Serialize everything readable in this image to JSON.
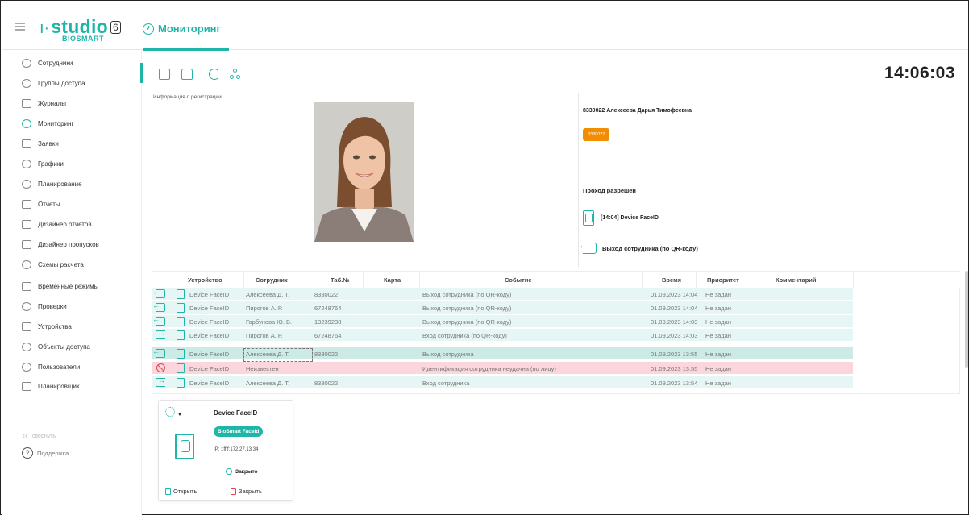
{
  "header": {
    "logo_text": "studio",
    "logo_version": "6",
    "logo_sub": "BIOSMART",
    "title": "Мониторинг"
  },
  "sidebar": {
    "items": [
      {
        "label": "Сотрудники",
        "icon": "person-icon"
      },
      {
        "label": "Группы доступа",
        "icon": "group-icon"
      },
      {
        "label": "Журналы",
        "icon": "journal-icon"
      },
      {
        "label": "Мониторинг",
        "icon": "gauge-icon"
      },
      {
        "label": "Заявки",
        "icon": "request-icon"
      },
      {
        "label": "Графики",
        "icon": "schedule-icon"
      },
      {
        "label": "Планирование",
        "icon": "planning-icon"
      },
      {
        "label": "Отчеты",
        "icon": "report-icon"
      },
      {
        "label": "Дизайнер отчетов",
        "icon": "report-designer-icon"
      },
      {
        "label": "Дизайнер пропусков",
        "icon": "pass-designer-icon"
      },
      {
        "label": "Схемы расчета",
        "icon": "calc-scheme-icon"
      },
      {
        "label": "Временные режимы",
        "icon": "time-mode-icon"
      },
      {
        "label": "Проверки",
        "icon": "eye-icon"
      },
      {
        "label": "Устройства",
        "icon": "devices-icon"
      },
      {
        "label": "Объекты доступа",
        "icon": "access-objects-icon"
      },
      {
        "label": "Пользователи",
        "icon": "users-icon"
      },
      {
        "label": "Планировщик",
        "icon": "scheduler-icon"
      }
    ],
    "collapse_label": "свернуть",
    "support_label": "Поддержка"
  },
  "clock": "14:06:03",
  "registration": {
    "caption": "Информация о регистрации",
    "employee_name": "8330022 Алексеева Дарья Тимофеевна",
    "badge": "8330022",
    "pass_status": "Проход разрешен",
    "device_line": "[14:04] Device FaceID",
    "event_line": "Выход сотрудника (по QR-коду)"
  },
  "table": {
    "headers": [
      "Устройство",
      "Сотрудник",
      "Таб.№",
      "Карта",
      "Событие",
      "Время",
      "Приоритет",
      "Комментарий"
    ],
    "rows": [
      {
        "icon": "exit",
        "device": "Device FaceID",
        "employee": "Алексеева Д. Т.",
        "tab": "8330022",
        "card": "",
        "event": "Выход сотрудника (по QR-коду)",
        "time": "01.09.2023 14:04",
        "priority": "Не задан",
        "comment": ""
      },
      {
        "icon": "exit",
        "device": "Device FaceID",
        "employee": "Пирогов А. Р.",
        "tab": "67248764",
        "card": "",
        "event": "Выход сотрудника (по QR-коду)",
        "time": "01.09.2023 14:04",
        "priority": "Не задан",
        "comment": ""
      },
      {
        "icon": "exit",
        "device": "Device FaceID",
        "employee": "Горбунова Ю. В.",
        "tab": "13239238",
        "card": "",
        "event": "Выход сотрудника (по QR-коду)",
        "time": "01.09.2023 14:03",
        "priority": "Не задан",
        "comment": ""
      },
      {
        "icon": "enter",
        "device": "Device FaceID",
        "employee": "Пирогов А. Р.",
        "tab": "67248764",
        "card": "",
        "event": "Вход сотрудника (по QR-коду)",
        "time": "01.09.2023 14:03",
        "priority": "Не задан",
        "comment": ""
      },
      {
        "icon": "exit",
        "device": "Device FaceID",
        "employee": "Алексеева Д. Т.",
        "tab": "8330022",
        "card": "",
        "event": "Выход сотрудника",
        "time": "01.09.2023 13:55",
        "priority": "Не задан",
        "comment": ""
      },
      {
        "icon": "block",
        "device": "Device FaceID",
        "employee": "Неизвестен",
        "tab": "",
        "card": "",
        "event": "Идентификация сотрудника неудачна (по лицу)",
        "time": "01.09.2023 13:55",
        "priority": "Не задан",
        "comment": ""
      },
      {
        "icon": "enter",
        "device": "Device FaceID",
        "employee": "Алексеева Д. Т.",
        "tab": "8330022",
        "card": "",
        "event": "Вход сотрудника",
        "time": "01.09.2023 13:54",
        "priority": "Не задан",
        "comment": ""
      }
    ]
  },
  "device_card": {
    "name": "Device FaceID",
    "tag": "BioSmart FaceId",
    "ip": "IP: ::ffff:172.27.13.34",
    "status": "Закрыто",
    "open_label": "Открыть",
    "close_label": "Закрыть"
  },
  "colors": {
    "accent": "#1fb6a8",
    "badge": "#f28c00",
    "row_normal": "#e6f6f5",
    "row_selected": "#cdebe6",
    "row_error": "#fbd6dc",
    "error_icon": "#e8455a"
  }
}
